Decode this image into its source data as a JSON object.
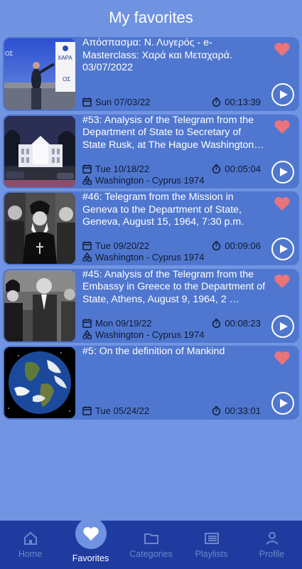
{
  "header": {
    "title": "My favorites"
  },
  "items": [
    {
      "title": "Απόσπασμα: Ν. Λυγερός - e-Masterclass: Χαρά και Μεταχαρά. 03/07/2022",
      "date": "Sun 07/03/22",
      "duration": "00:13:39",
      "subtitle": null
    },
    {
      "title": "#53: Analysis of the Telegram from the Department of State to Secretary of State Rusk, at The Hague Washington…",
      "date": "Tue 10/18/22",
      "duration": "00:05:04",
      "subtitle": "Washington - Cyprus 1974"
    },
    {
      "title": "#46: Telegram from the Mission in Geneva to the Department of State, Geneva, August 15, 1964, 7:30 p.m.",
      "date": "Tue 09/20/22",
      "duration": "00:09:06",
      "subtitle": "Washington - Cyprus 1974"
    },
    {
      "title": "#45: Analysis of the Telegram from the Embassy in Greece to the Department of State, Athens, August 9, 1964, 2 …",
      "date": "Mon 09/19/22",
      "duration": "00:08:23",
      "subtitle": "Washington - Cyprus 1974"
    },
    {
      "title": "#5: On the definition of Mankind",
      "date": "Tue 05/24/22",
      "duration": "00:33:01",
      "subtitle": null
    }
  ],
  "thumbnail_text": {
    "sign_top": "ΟΣ",
    "sign_mid": "ΧΑΡΑ",
    "sign_bottom": "ΟΣ"
  },
  "nav": [
    {
      "label": "Home",
      "icon": "home-icon"
    },
    {
      "label": "Favorites",
      "icon": "heart-icon",
      "active": true
    },
    {
      "label": "Categories",
      "icon": "folder-icon"
    },
    {
      "label": "Playlists",
      "icon": "list-icon"
    },
    {
      "label": "Profile",
      "icon": "person-icon"
    }
  ],
  "colors": {
    "background": "#7195e2",
    "card": "#5077cf",
    "nav": "#1f3ba0",
    "heart": "#e9747a"
  }
}
